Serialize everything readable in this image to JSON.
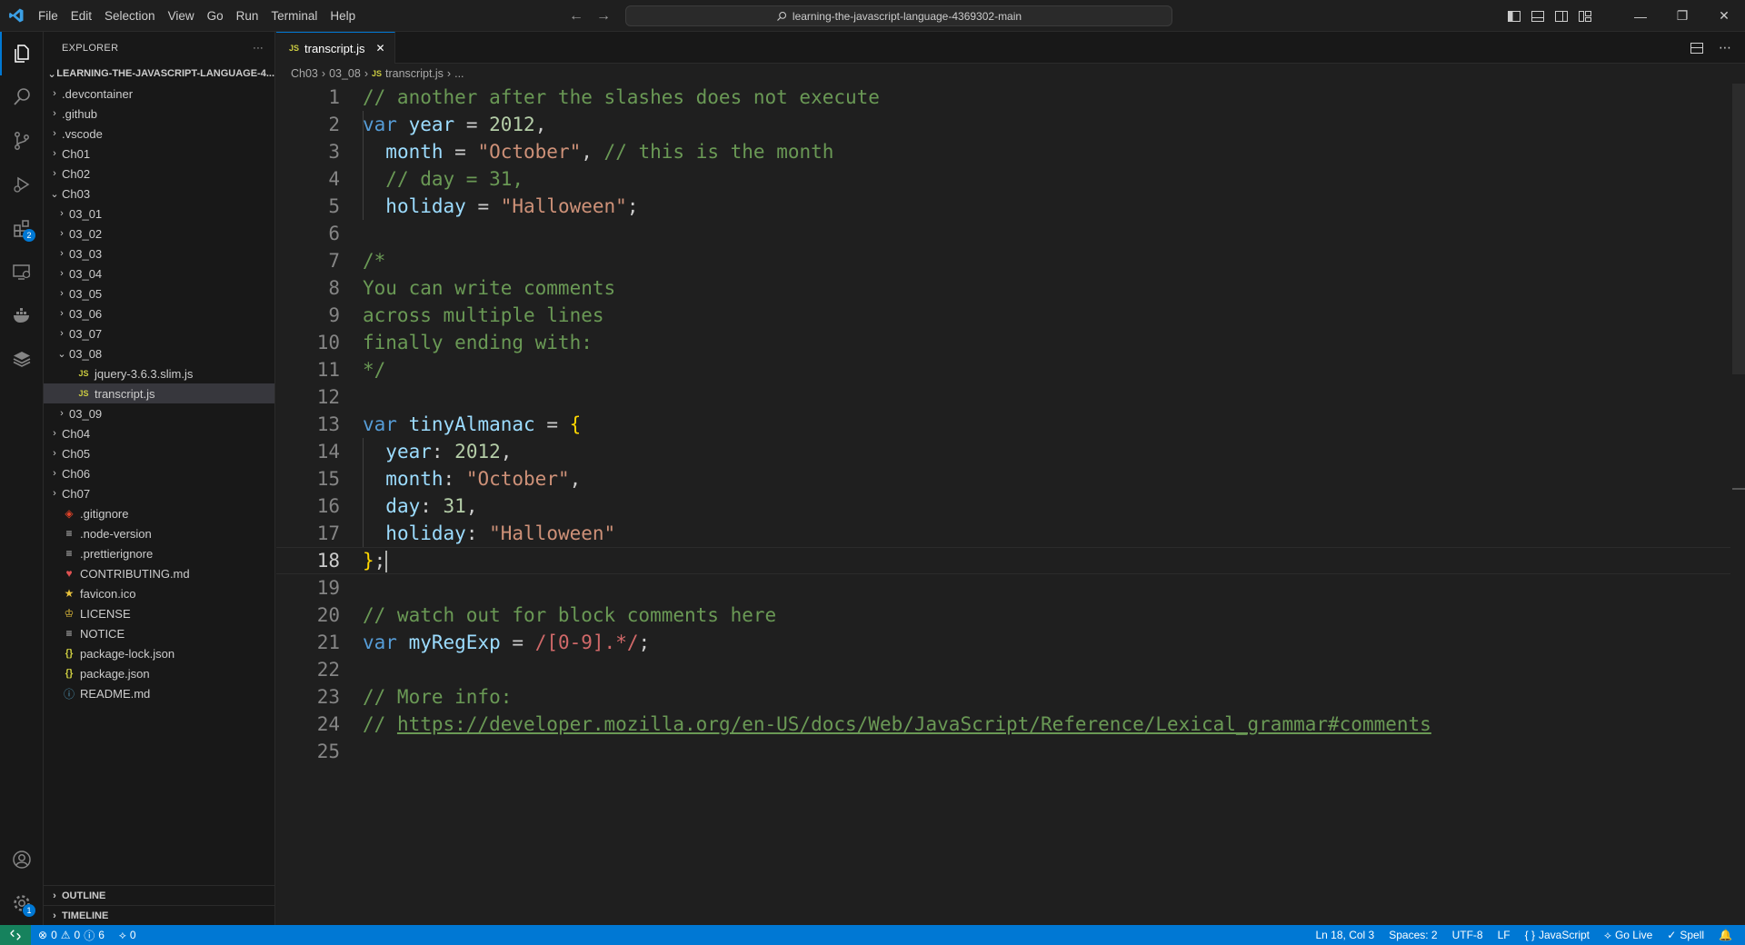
{
  "titlebar": {
    "menu": [
      "File",
      "Edit",
      "Selection",
      "View",
      "Go",
      "Run",
      "Terminal",
      "Help"
    ],
    "search_text": "learning-the-javascript-language-4369302-main"
  },
  "activity": {
    "extensions_badge": "2",
    "settings_badge": "1"
  },
  "sidebar": {
    "header": "EXPLORER",
    "more": "···",
    "root": "LEARNING-THE-JAVASCRIPT-LANGUAGE-4...",
    "items": [
      {
        "label": ".devcontainer",
        "kind": "folder",
        "depth": 1,
        "expanded": false
      },
      {
        "label": ".github",
        "kind": "folder",
        "depth": 1,
        "expanded": false
      },
      {
        "label": ".vscode",
        "kind": "folder",
        "depth": 1,
        "expanded": false
      },
      {
        "label": "Ch01",
        "kind": "folder",
        "depth": 1,
        "expanded": false
      },
      {
        "label": "Ch02",
        "kind": "folder",
        "depth": 1,
        "expanded": false
      },
      {
        "label": "Ch03",
        "kind": "folder",
        "depth": 1,
        "expanded": true
      },
      {
        "label": "03_01",
        "kind": "folder",
        "depth": 2,
        "expanded": false
      },
      {
        "label": "03_02",
        "kind": "folder",
        "depth": 2,
        "expanded": false
      },
      {
        "label": "03_03",
        "kind": "folder",
        "depth": 2,
        "expanded": false
      },
      {
        "label": "03_04",
        "kind": "folder",
        "depth": 2,
        "expanded": false
      },
      {
        "label": "03_05",
        "kind": "folder",
        "depth": 2,
        "expanded": false
      },
      {
        "label": "03_06",
        "kind": "folder",
        "depth": 2,
        "expanded": false
      },
      {
        "label": "03_07",
        "kind": "folder",
        "depth": 2,
        "expanded": false
      },
      {
        "label": "03_08",
        "kind": "folder",
        "depth": 2,
        "expanded": true
      },
      {
        "label": "jquery-3.6.3.slim.js",
        "kind": "js",
        "depth": 3
      },
      {
        "label": "transcript.js",
        "kind": "js",
        "depth": 3,
        "selected": true
      },
      {
        "label": "03_09",
        "kind": "folder",
        "depth": 2,
        "expanded": false
      },
      {
        "label": "Ch04",
        "kind": "folder",
        "depth": 1,
        "expanded": false
      },
      {
        "label": "Ch05",
        "kind": "folder",
        "depth": 1,
        "expanded": false
      },
      {
        "label": "Ch06",
        "kind": "folder",
        "depth": 1,
        "expanded": false
      },
      {
        "label": "Ch07",
        "kind": "folder",
        "depth": 1,
        "expanded": false
      },
      {
        "label": ".gitignore",
        "kind": "git",
        "depth": 1
      },
      {
        "label": ".node-version",
        "kind": "lines",
        "depth": 1
      },
      {
        "label": ".prettierignore",
        "kind": "lines",
        "depth": 1
      },
      {
        "label": "CONTRIBUTING.md",
        "kind": "md-red",
        "depth": 1
      },
      {
        "label": "favicon.ico",
        "kind": "star",
        "depth": 1
      },
      {
        "label": "LICENSE",
        "kind": "license",
        "depth": 1
      },
      {
        "label": "NOTICE",
        "kind": "lines",
        "depth": 1
      },
      {
        "label": "package-lock.json",
        "kind": "json",
        "depth": 1
      },
      {
        "label": "package.json",
        "kind": "json",
        "depth": 1
      },
      {
        "label": "README.md",
        "kind": "info",
        "depth": 1
      }
    ],
    "outline": "OUTLINE",
    "timeline": "TIMELINE"
  },
  "editor": {
    "tab_label": "transcript.js",
    "tab_icon": "JS",
    "breadcrumb": [
      "Ch03",
      "03_08",
      "transcript.js",
      "..."
    ],
    "current_line": 18,
    "lines": [
      [
        {
          "t": "// another after the slashes does not execute",
          "c": "com"
        }
      ],
      [
        {
          "t": "var",
          "c": "kw"
        },
        {
          "t": " "
        },
        {
          "t": "year",
          "c": "var"
        },
        {
          "t": " = "
        },
        {
          "t": "2012",
          "c": "num"
        },
        {
          "t": ","
        }
      ],
      [
        {
          "t": "  "
        },
        {
          "t": "month",
          "c": "var"
        },
        {
          "t": " = "
        },
        {
          "t": "\"October\"",
          "c": "str"
        },
        {
          "t": ", "
        },
        {
          "t": "// this is the month",
          "c": "com"
        }
      ],
      [
        {
          "t": "  "
        },
        {
          "t": "// day = 31,",
          "c": "com"
        }
      ],
      [
        {
          "t": "  "
        },
        {
          "t": "holiday",
          "c": "var"
        },
        {
          "t": " = "
        },
        {
          "t": "\"Halloween\"",
          "c": "str"
        },
        {
          "t": ";"
        }
      ],
      [],
      [
        {
          "t": "/*",
          "c": "com"
        }
      ],
      [
        {
          "t": "You can write comments",
          "c": "com"
        }
      ],
      [
        {
          "t": "across multiple lines",
          "c": "com"
        }
      ],
      [
        {
          "t": "finally ending with:",
          "c": "com"
        }
      ],
      [
        {
          "t": "*/",
          "c": "com"
        }
      ],
      [],
      [
        {
          "t": "var",
          "c": "kw"
        },
        {
          "t": " "
        },
        {
          "t": "tinyAlmanac",
          "c": "var"
        },
        {
          "t": " = "
        },
        {
          "t": "{",
          "c": "br"
        }
      ],
      [
        {
          "t": "  "
        },
        {
          "t": "year",
          "c": "var"
        },
        {
          "t": ": "
        },
        {
          "t": "2012",
          "c": "num"
        },
        {
          "t": ","
        }
      ],
      [
        {
          "t": "  "
        },
        {
          "t": "month",
          "c": "var"
        },
        {
          "t": ": "
        },
        {
          "t": "\"October\"",
          "c": "str"
        },
        {
          "t": ","
        }
      ],
      [
        {
          "t": "  "
        },
        {
          "t": "day",
          "c": "var"
        },
        {
          "t": ": "
        },
        {
          "t": "31",
          "c": "num"
        },
        {
          "t": ","
        }
      ],
      [
        {
          "t": "  "
        },
        {
          "t": "holiday",
          "c": "var"
        },
        {
          "t": ": "
        },
        {
          "t": "\"Halloween\"",
          "c": "str"
        }
      ],
      [
        {
          "t": "}",
          "c": "br"
        },
        {
          "t": ";"
        }
      ],
      [],
      [
        {
          "t": "// watch out for block comments here",
          "c": "com"
        }
      ],
      [
        {
          "t": "var",
          "c": "kw"
        },
        {
          "t": " "
        },
        {
          "t": "myRegExp",
          "c": "var"
        },
        {
          "t": " = "
        },
        {
          "t": "/[0-9].*/",
          "c": "rx"
        },
        {
          "t": ";"
        }
      ],
      [],
      [
        {
          "t": "// More info:",
          "c": "com"
        }
      ],
      [
        {
          "t": "// ",
          "c": "com"
        },
        {
          "t": "https://developer.mozilla.org/en-US/docs/Web/JavaScript/Reference/Lexical_grammar#comments",
          "c": "link"
        }
      ],
      []
    ]
  },
  "status": {
    "errors": "0",
    "warnings": "0",
    "infos": "6",
    "ports": "0",
    "position": "Ln 18, Col 3",
    "spaces": "Spaces: 2",
    "encoding": "UTF-8",
    "eol": "LF",
    "language": "JavaScript",
    "golive": "Go Live",
    "spell": "Spell"
  },
  "colors": {
    "accent": "#0078d4",
    "remote": "#16825d"
  }
}
